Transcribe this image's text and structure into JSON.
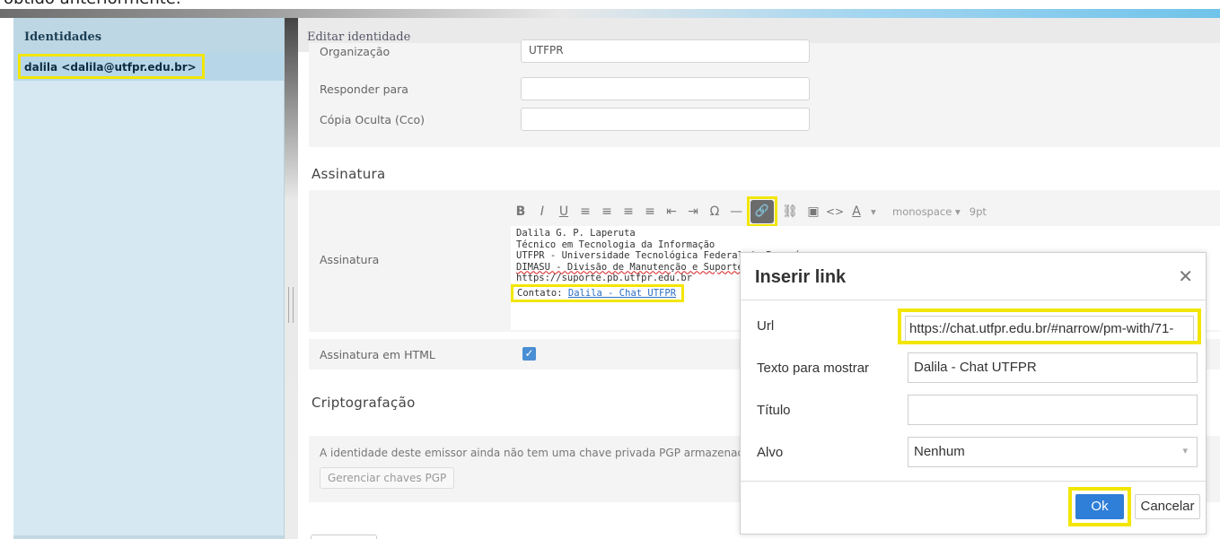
{
  "caption": "obtido anteriormente.",
  "sidebar": {
    "title": "Identidades",
    "items": [
      {
        "label": "dalila <dalila@utfpr.edu.br>"
      }
    ]
  },
  "main": {
    "title": "Editar identidade",
    "fields": [
      {
        "label": "Organização",
        "value": "UTFPR"
      },
      {
        "label": "Responder para",
        "value": ""
      },
      {
        "label": "Cópia Oculta (Cco)",
        "value": ""
      }
    ],
    "signature_section": "Assinatura",
    "signature_label": "Assinatura",
    "toolbar": {
      "bold": "B",
      "italic": "I",
      "underline": "U",
      "omega": "Ω",
      "hr": "—",
      "source": "<>",
      "color": "A",
      "font": "monospace",
      "size": "9pt"
    },
    "signature_lines": [
      "Dalila G. P. Laperuta",
      "Técnico em Tecnologia da Informação",
      "UTFPR - Universidade Tecnológica Federal do Paraná",
      "DIMASU - Divisão de Manutenção e Suporte",
      "https://suporte.pb.utfpr.edu.br"
    ],
    "contact_prefix": "Contato: ",
    "contact_link": "Dalila - Chat UTFPR",
    "html_signature_label": "Assinatura em HTML",
    "crypto_section": "Criptografação",
    "crypto_message": "A identidade deste emissor ainda não tem uma chave privada PGP armazenada.",
    "pgp_button": "Gerenciar chaves PGP"
  },
  "dialog": {
    "title": "Inserir link",
    "url_label": "Url",
    "url_value": "https://chat.utfpr.edu.br/#narrow/pm-with/71-",
    "text_label": "Texto para mostrar",
    "text_value": "Dalila - Chat UTFPR",
    "title_label": "Título",
    "title_value": "",
    "target_label": "Alvo",
    "target_value": "Nenhum",
    "ok": "Ok",
    "cancel": "Cancelar"
  },
  "colors": {
    "highlight": "#f2e600",
    "primary": "#2f7ed8",
    "sidebar": "#d6e9f3"
  }
}
